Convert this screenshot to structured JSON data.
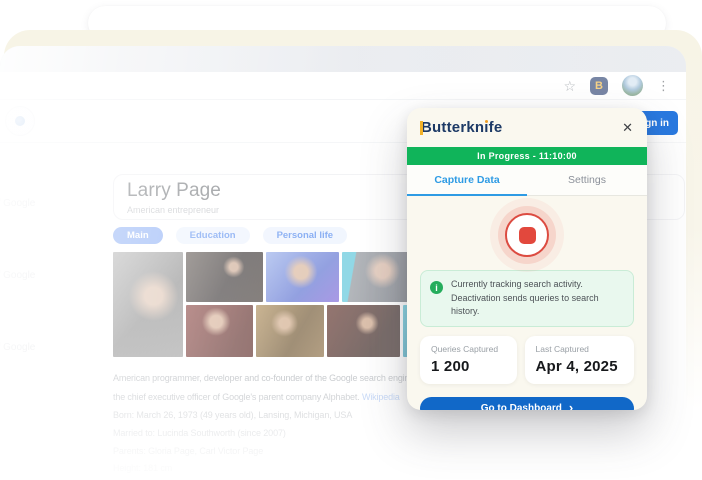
{
  "browser": {
    "toolbar": {
      "star_icon": "☆",
      "extension_badge": "B",
      "menu_icon": "⋮"
    },
    "sign_in_button": "Sign in",
    "page": {
      "title": "Larry Page",
      "subtitle": "American entrepreneur",
      "pills": [
        {
          "label": "Main"
        },
        {
          "label": "Education"
        },
        {
          "label": "Personal life"
        }
      ],
      "description_line1": "American programmer, developer and co-founder of the Google search engine. Page is",
      "description_line2": "the chief executive officer of Google's parent company Alphabet.",
      "wikipedia_link": "Wikipedia",
      "facts": [
        "Born: March 26, 1973 (49 years old), Lansing, Michigan, USA",
        "Married to: Lucinda Southworth (since 2007)",
        "Parents: Gloria Page, Carl Victor Page",
        "Height: 181 cm"
      ],
      "edge_fragments": [
        "of Google",
        "of Google",
        "of Google"
      ]
    }
  },
  "popup": {
    "title": "Butterknife",
    "title_parts": {
      "a": "Butterkn",
      "i": "ı",
      "b": "fe"
    },
    "close_icon": "✕",
    "status_bar": "In Progress - 11:10:00",
    "tabs": [
      {
        "label": "Capture Data",
        "active": true
      },
      {
        "label": "Settings",
        "active": false
      }
    ],
    "record_state": "recording",
    "info_line1": "Currently tracking search activity.",
    "info_line2": "Deactivation sends queries to search history.",
    "info_icon": "i",
    "stats": [
      {
        "label": "Queries Captured",
        "value": "1 200"
      },
      {
        "label": "Last Captured",
        "value": "Apr 4, 2025"
      }
    ],
    "dashboard_button": "Go to Dashboard",
    "dashboard_chevron": "›",
    "colors": {
      "status_green": "#10b45a",
      "tab_blue": "#2e9be4",
      "button_blue": "#1168c8",
      "record_red": "#e2483d",
      "brand_navy": "#1d3a66",
      "brand_yellow": "#f3b229"
    }
  }
}
